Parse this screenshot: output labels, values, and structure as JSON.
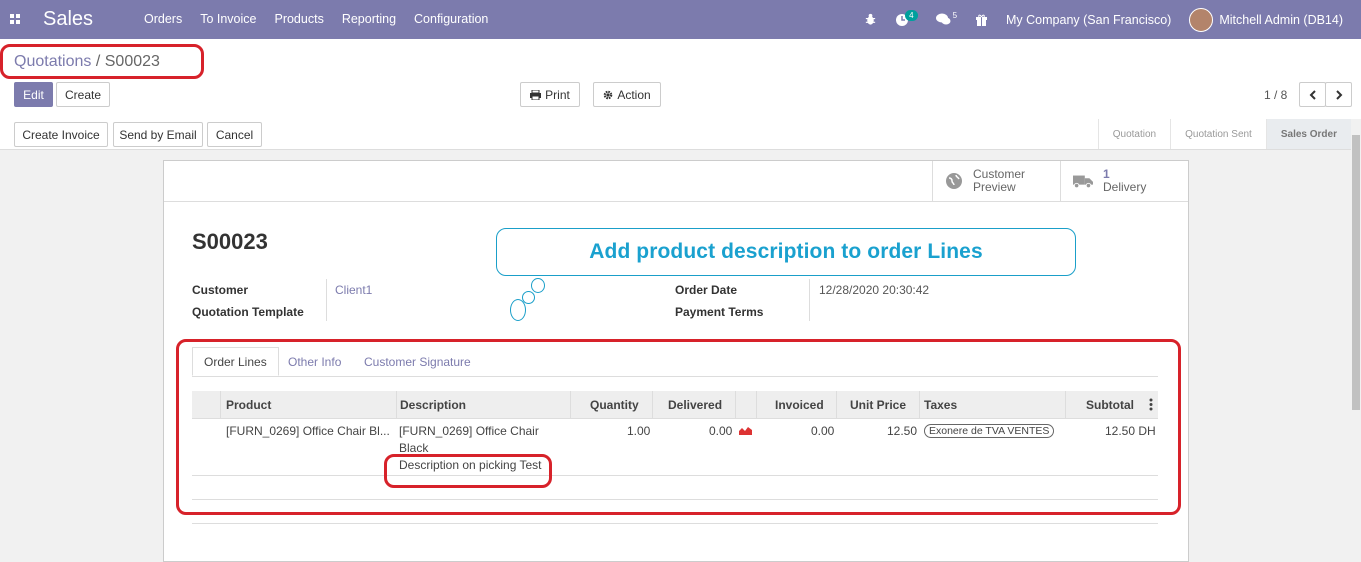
{
  "navbar": {
    "app_name": "Sales",
    "menu": [
      "Orders",
      "To Invoice",
      "Products",
      "Reporting",
      "Configuration"
    ],
    "activity_count": "4",
    "message_count": "5",
    "company": "My Company (San Francisco)",
    "user": "Mitchell Admin (DB14)"
  },
  "breadcrumb": {
    "parent": "Quotations",
    "sep": "/",
    "current": "S00023"
  },
  "buttons": {
    "edit": "Edit",
    "create": "Create",
    "print": "Print",
    "action": "Action",
    "create_invoice": "Create Invoice",
    "send_email": "Send by Email",
    "cancel": "Cancel"
  },
  "pager": {
    "value": "1 / 8"
  },
  "stages": [
    "Quotation",
    "Quotation Sent",
    "Sales Order"
  ],
  "smart_buttons": {
    "preview_line1": "Customer",
    "preview_line2": "Preview",
    "delivery_count": "1",
    "delivery_label": "Delivery"
  },
  "order": {
    "name": "S00023",
    "customer_label": "Customer",
    "customer_value": "Client1",
    "template_label": "Quotation Template",
    "order_date_label": "Order Date",
    "order_date_value": "12/28/2020 20:30:42",
    "payment_terms_label": "Payment Terms"
  },
  "tabs": [
    "Order Lines",
    "Other Info",
    "Customer Signature"
  ],
  "table": {
    "headers": [
      "Product",
      "Description",
      "Quantity",
      "Delivered",
      "Invoiced",
      "Unit Price",
      "Taxes",
      "Subtotal"
    ],
    "row": {
      "product": "[FURN_0269] Office Chair Bl...",
      "desc1": "[FURN_0269] Office Chair",
      "desc2": "Black",
      "desc3": "Description on picking Test",
      "quantity": "1.00",
      "delivered": "0.00",
      "invoiced": "0.00",
      "unit_price": "12.50",
      "tax": "Exonere de TVA VENTES",
      "subtotal": "12.50 DH"
    }
  },
  "annotation": {
    "callout": "Add product description to order Lines"
  },
  "colors": {
    "navbar": "#7c7bad",
    "accent": "#7c7bad",
    "annotation_blue": "#1aa1cf",
    "annotation_red": "#d7222a"
  }
}
